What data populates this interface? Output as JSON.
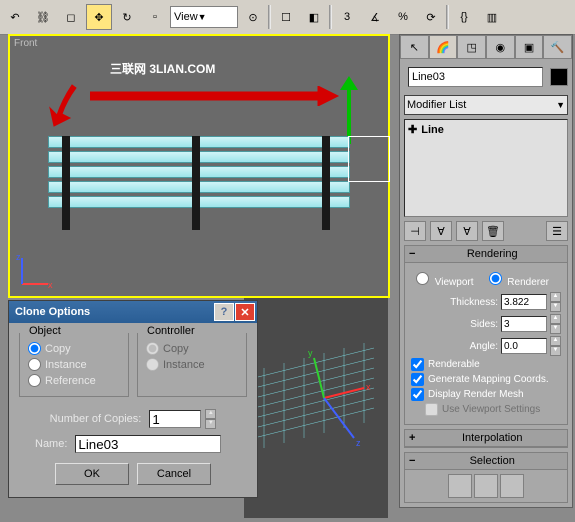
{
  "toolbar": {
    "view_dd": "View"
  },
  "viewport": {
    "label": "Front",
    "watermark": "三联网 3LIAN.COM"
  },
  "clone": {
    "title": "Clone Options",
    "obj_label": "Object",
    "ctrl_label": "Controller",
    "copy": "Copy",
    "instance": "Instance",
    "reference": "Reference",
    "numcopies_label": "Number of Copies:",
    "numcopies": "1",
    "name_label": "Name:",
    "name_value": "Line03",
    "ok": "OK",
    "cancel": "Cancel"
  },
  "panel": {
    "obj_name": "Line03",
    "mod_list": "Modifier List",
    "stack_item": "Line",
    "rendering": {
      "title": "Rendering",
      "viewport": "Viewport",
      "renderer": "Renderer",
      "thickness_l": "Thickness:",
      "thickness": "3.822",
      "sides_l": "Sides:",
      "sides": "3",
      "angle_l": "Angle:",
      "angle": "0.0",
      "renderable": "Renderable",
      "genmap": "Generate Mapping Coords.",
      "disprender": "Display Render Mesh",
      "useviewport": "Use Viewport Settings"
    },
    "interp": "Interpolation",
    "selection": "Selection"
  }
}
